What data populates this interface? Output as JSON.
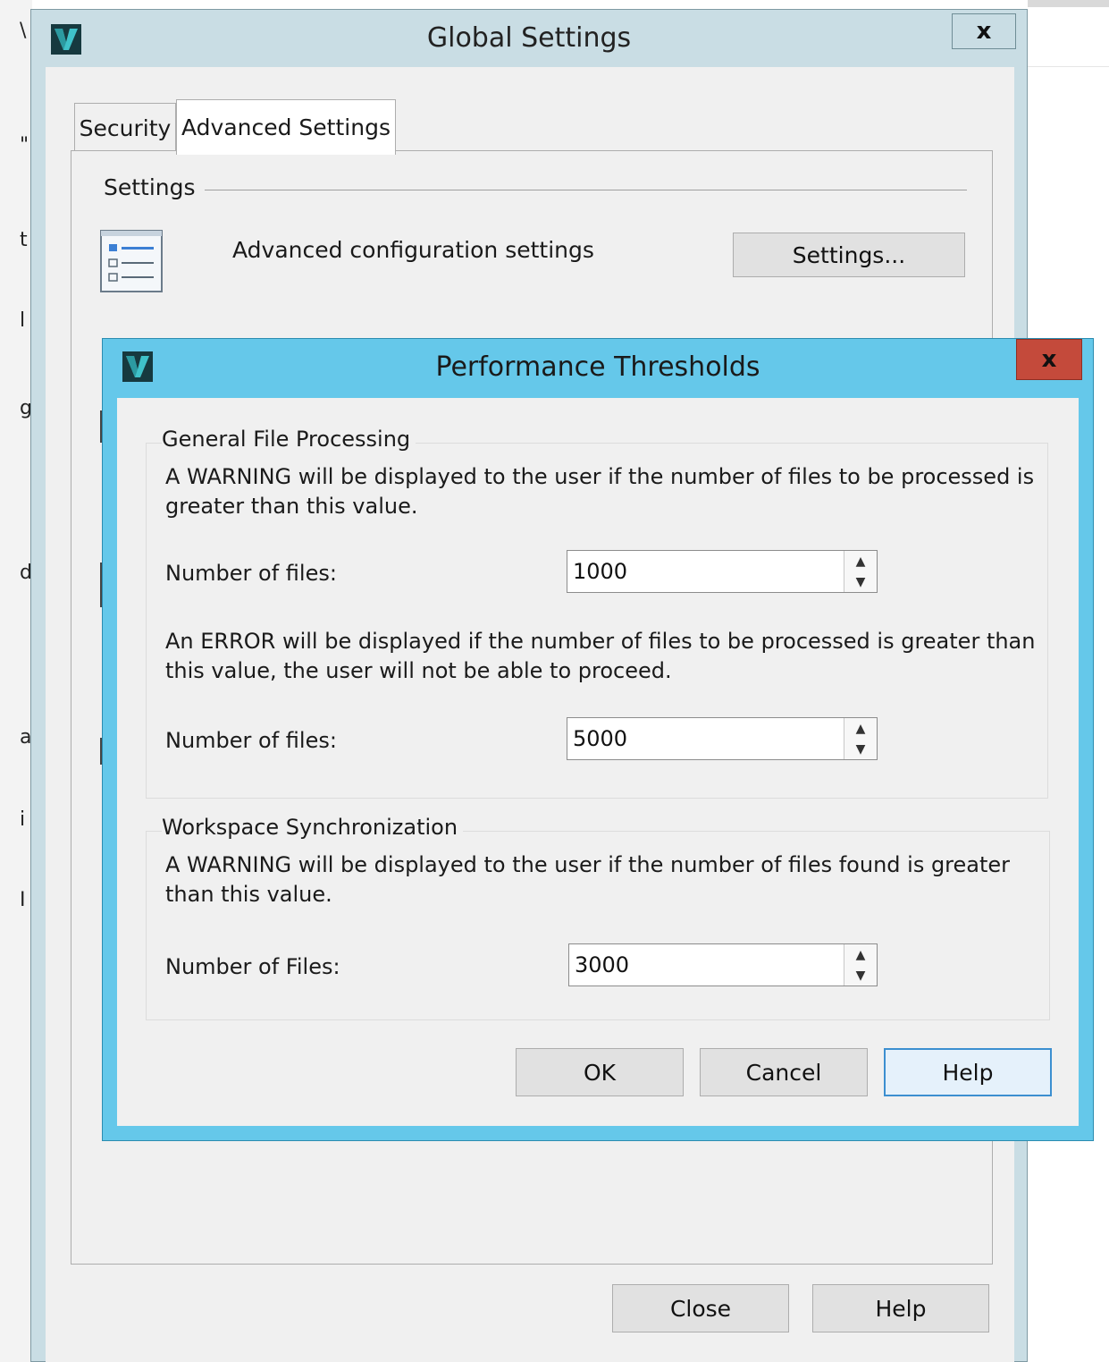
{
  "background": {
    "glyphs": [
      "\\",
      "\"",
      "t",
      "l",
      "g",
      "d",
      "a",
      "i",
      "I"
    ]
  },
  "global_settings": {
    "title": "Global Settings",
    "close_glyph": "x",
    "tabs": [
      {
        "label": "Security",
        "active": false
      },
      {
        "label": "Advanced Settings",
        "active": true
      }
    ],
    "group_caption": "Settings",
    "advanced_label": "Advanced configuration settings",
    "settings_button": "Settings...",
    "close_button": "Close",
    "help_button": "Help"
  },
  "performance_thresholds": {
    "title": "Performance Thresholds",
    "close_glyph": "x",
    "general": {
      "legend": "General File Processing",
      "warning_text": "A WARNING will be displayed to the user if the number of files to be processed is greater than this value.",
      "warning_label": "Number of files:",
      "warning_value": "1000",
      "error_text": "An ERROR will be displayed if the number of files to be processed is greater than this value, the user will not be able to proceed.",
      "error_label": "Number of files:",
      "error_value": "5000"
    },
    "workspace": {
      "legend": "Workspace Synchronization",
      "warning_text": "A WARNING will be displayed to the user if the number of files found is greater than this value.",
      "label": "Number of Files:",
      "value": "3000"
    },
    "ok_button": "OK",
    "cancel_button": "Cancel",
    "help_button": "Help"
  },
  "colors": {
    "dialog_frame_active": "#65c8ea",
    "dialog_frame_inactive": "#c9dde4",
    "close_button_active": "#c44a3b",
    "logo_teal": "#1a8c8c"
  },
  "icons": [
    "app-logo-icon",
    "settings-list-icon",
    "close-icon",
    "spin-up-icon",
    "spin-down-icon"
  ]
}
